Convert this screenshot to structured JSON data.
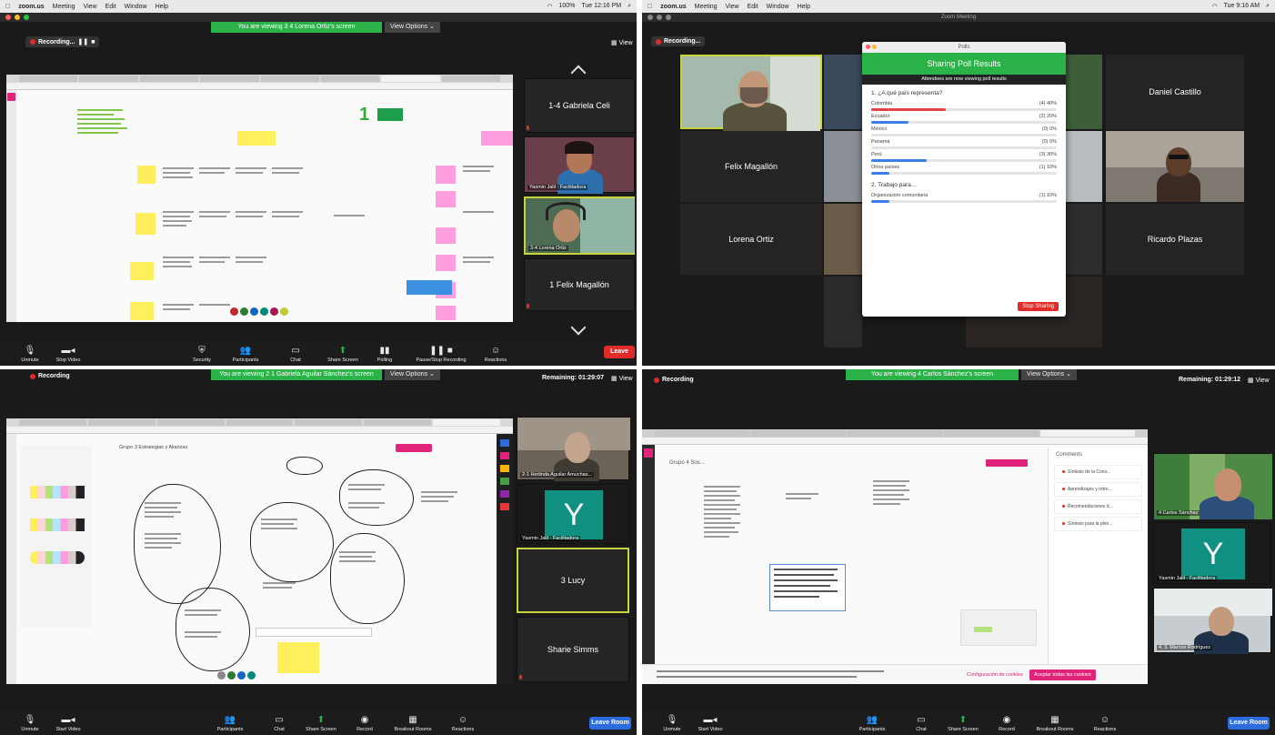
{
  "menubar_left": {
    "apple": "",
    "app": "zoom.us",
    "menus": [
      "Meeting",
      "View",
      "Edit",
      "Window",
      "Help"
    ],
    "clock": "Tue 12:16 PM",
    "battery": "100%"
  },
  "menubar_right": {
    "app": "zoom.us",
    "menus": [
      "Meeting",
      "View",
      "Edit",
      "Window",
      "Help"
    ],
    "clock": "Tue 9:16 AM"
  },
  "window_title_tr": "Zoom Meeting",
  "tl": {
    "banner": "You are viewing 3 4 Lorena Ortiz's screen",
    "view_options": "View Options ⌄",
    "recording": "Recording...",
    "view": "View",
    "tiles": [
      "1-4 Gabriela Celi",
      "Yasmin Jalil - Facilitadora",
      "3-4 Lorena Ortiz",
      "1 Felix Magallón"
    ],
    "toolbar": [
      "Unmute",
      "Stop Video",
      "Security",
      "Participants",
      "Chat",
      "Share Screen",
      "Polling",
      "Pause/Stop Recording",
      "Reactions"
    ],
    "leave": "Leave",
    "board_number": "1"
  },
  "tr": {
    "recording": "Recording...",
    "names": [
      "Daniel Castillo",
      "Felix Magallón",
      "Lorena Ortiz",
      "Ricardo Plazas"
    ],
    "poll": {
      "window_title": "Polls",
      "header": "Sharing Poll Results",
      "notice": "Attendees are now viewing poll results",
      "q1": "1. ¿A qué país representa?",
      "options": [
        {
          "label": "Colombia",
          "value": "(4) 40%",
          "pct": 40,
          "color": "#e04545"
        },
        {
          "label": "Ecuador",
          "value": "(2) 20%",
          "pct": 20,
          "color": "#3d7ee6"
        },
        {
          "label": "México",
          "value": "(0) 0%",
          "pct": 0,
          "color": "#3d7ee6"
        },
        {
          "label": "Panamá",
          "value": "(0) 0%",
          "pct": 0,
          "color": "#3d7ee6"
        },
        {
          "label": "Perú",
          "value": "(3) 30%",
          "pct": 30,
          "color": "#3d7ee6"
        },
        {
          "label": "Otros países",
          "value": "(1) 10%",
          "pct": 10,
          "color": "#3d7ee6"
        }
      ],
      "q2": "2. Trabajo para…",
      "options2": [
        {
          "label": "Organización comunitaria",
          "value": "(1) 10%",
          "pct": 10,
          "color": "#3d7ee6"
        }
      ],
      "stop": "Stop Sharing"
    }
  },
  "bl": {
    "banner": "You are viewing 2 1 Gabriela Aguilar Sánchez's screen",
    "view_options": "View Options ⌄",
    "recording": "Recording",
    "remaining": "Remaining: 01:29:07",
    "view": "View",
    "tiles": [
      "2-1 Herlinda Aguilar Amuchas...",
      "Yasmin Jalil - Facilitadora",
      "3 Lucy",
      "Sharie Simms"
    ],
    "avatar_letter": "Y",
    "toolbar": [
      "Unmute",
      "Start Video",
      "Participants",
      "Chat",
      "Share Screen",
      "Record",
      "Breakout Rooms",
      "Reactions"
    ],
    "leave": "Leave Room",
    "board_title": "Grupo 3 Estrategias y Alianzas"
  },
  "br": {
    "banner": "You are viewing 4 Carlos Sánchez's screen",
    "view_options": "View Options ⌄",
    "recording": "Recording",
    "remaining": "Remaining: 01:29:12",
    "view": "View",
    "tiles": [
      "4 Carlos Sánchez",
      "Yasmin Jalil - Facilitadora",
      "4. 3. Marcos Rodríguez"
    ],
    "avatar_letter": "Y",
    "toolbar": [
      "Unmute",
      "Start Video",
      "Participants",
      "Chat",
      "Share Screen",
      "Record",
      "Breakout Rooms",
      "Reactions"
    ],
    "leave": "Leave Room",
    "board_title": "Grupo 4 Sos...",
    "comments_title": "Comments",
    "comments": [
      "Síntesis de la Conv...",
      "Aprendizajes y retro...",
      "Recomendaciones d...",
      "Síntesis para la plen..."
    ],
    "cookie_config": "Configuración de cookies",
    "cookie_accept": "Aceptar todas las cookies"
  }
}
